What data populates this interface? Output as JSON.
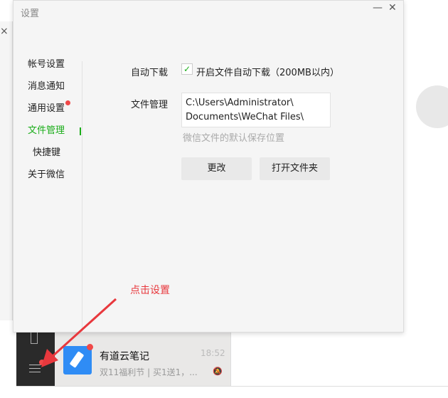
{
  "background": {
    "close_glyph": "×"
  },
  "dialog": {
    "title": "设置",
    "minimize": "—",
    "close": "✕",
    "nav": [
      "帐号设置",
      "消息通知",
      "通用设置",
      "文件管理",
      "快捷键",
      "关于微信"
    ],
    "active": "文件管理",
    "auto_download_label": "自动下载",
    "auto_download_option": "开启文件自动下载（200MB以内）",
    "auto_download_checked": true,
    "check_glyph": "✓",
    "file_mgmt_label": "文件管理",
    "path_line1": "C:\\Users\\Administrator\\",
    "path_line2": "Documents\\WeChat Files\\",
    "hint": "微信文件的默认保存位置",
    "change_button": "更改",
    "open_folder_button": "打开文件夹"
  },
  "annotation": "点击设置",
  "chat": {
    "name": "有道云笔记",
    "message": "双11福利节 | 买1送1，...",
    "time": "18:52",
    "mute_icon": "bell-off"
  },
  "colors": {
    "accent": "#1aad19",
    "annotation": "#e8383d",
    "badge": "#f04848"
  }
}
